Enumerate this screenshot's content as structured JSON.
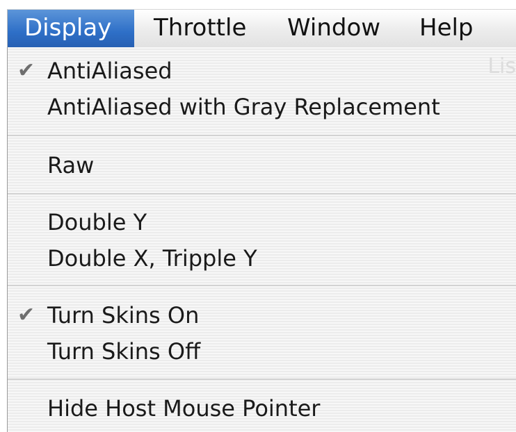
{
  "menubar": {
    "items": [
      {
        "label": "Display",
        "active": true
      },
      {
        "label": "Throttle",
        "active": false
      },
      {
        "label": "Window",
        "active": false
      },
      {
        "label": "Help",
        "active": false
      }
    ]
  },
  "behind_text": "Lis",
  "dropdown": {
    "items": [
      {
        "label": "AntiAliased",
        "checked": true,
        "check_icon": "checkmark-icon",
        "check_glyph": "✔"
      },
      {
        "label": "AntiAliased with Gray Replacement",
        "checked": false
      },
      {
        "label": "Raw",
        "checked": false
      },
      {
        "label": "Double Y",
        "checked": false
      },
      {
        "label": "Double X, Tripple Y",
        "checked": false
      },
      {
        "label": "Turn Skins On",
        "checked": true,
        "check_icon": "checkmark-icon",
        "check_glyph": "✔"
      },
      {
        "label": "Turn Skins Off",
        "checked": false
      },
      {
        "label": "Hide Host Mouse Pointer",
        "checked": false
      }
    ]
  },
  "colors": {
    "highlight": "#2e6fc7",
    "check": "#6e6e6e"
  }
}
